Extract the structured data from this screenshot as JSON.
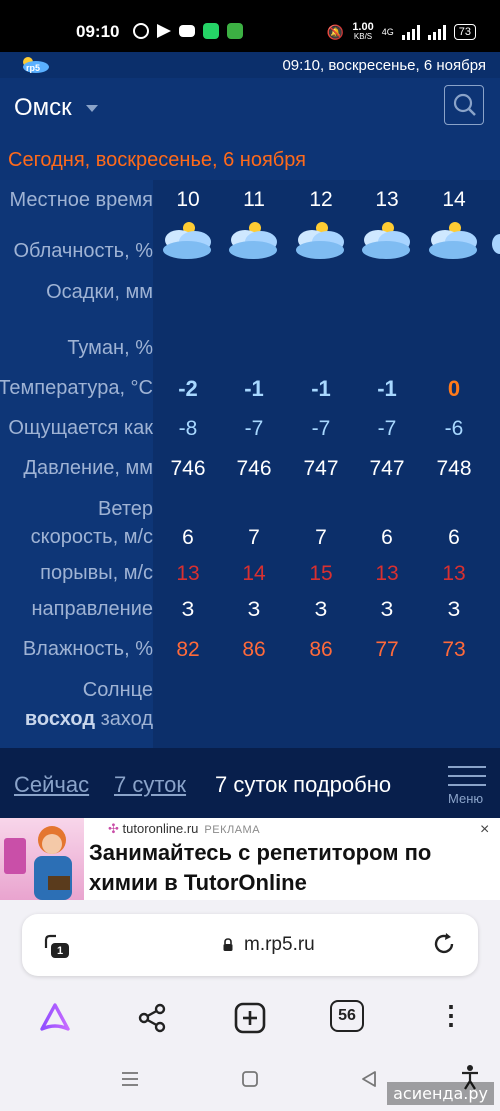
{
  "status_bar": {
    "time": "09:10",
    "net_speed": "1.00",
    "net_unit": "KB/S",
    "net_type": "4G",
    "battery": "73",
    "apps": [
      "whatsapp-icon",
      "telegram-icon",
      "youtube-icon",
      "phone-icon",
      "download-icon"
    ]
  },
  "header": {
    "logo_text": "rp5",
    "datetime": "09:10, воскресенье, 6 ноября"
  },
  "location": {
    "city": "Омск"
  },
  "date_heading": "Сегодня, воскресенье, 6 ноября",
  "row_labels": {
    "local_time": "Местное время",
    "cloudiness": "Облачность, %",
    "precipitation": "Осадки, мм",
    "fog": "Туман, %",
    "temperature": "Температура, °C",
    "feels_like": "Ощущается как",
    "pressure": "Давление, мм",
    "wind_title": "Ветер",
    "wind_speed": "скорость, м/с",
    "wind_gusts": "порывы, м/с",
    "wind_direction": "направление",
    "humidity": "Влажность, %",
    "sun_title": "Солнце",
    "sunrise": "восход",
    "sunset": "заход"
  },
  "forecast": {
    "hours": [
      "10",
      "11",
      "12",
      "13",
      "14"
    ],
    "temperature": [
      "-2",
      "-1",
      "-1",
      "-1",
      "0"
    ],
    "feels_like": [
      "-8",
      "-7",
      "-7",
      "-7",
      "-6"
    ],
    "pressure": [
      "746",
      "746",
      "747",
      "747",
      "748"
    ],
    "wind_speed": [
      "6",
      "7",
      "7",
      "6",
      "6"
    ],
    "wind_gusts": [
      "13",
      "14",
      "15",
      "13",
      "13"
    ],
    "wind_direction": [
      "З",
      "З",
      "З",
      "З",
      "З"
    ],
    "humidity": [
      "82",
      "86",
      "86",
      "77",
      "73"
    ]
  },
  "colors": {
    "cold_temp": "#a8d8ff",
    "zero_temp": "#ff7a1a",
    "gust": "#d93030",
    "humidity": "#ff6a3a",
    "accent_orange": "#ff6a1a"
  },
  "tabs": {
    "now": "Сейчас",
    "days7": "7 суток",
    "days7_detail": "7 суток подробно",
    "menu": "Меню"
  },
  "ad": {
    "source": "tutoronline.ru",
    "tag": "РЕКЛАМА",
    "title": "Занимайтесь с репетитором по химии в TutorOnline"
  },
  "browser": {
    "url": "m.rp5.ru",
    "tab_count": "56",
    "tabs_badge": "1"
  },
  "watermark": "асиенда.ру"
}
